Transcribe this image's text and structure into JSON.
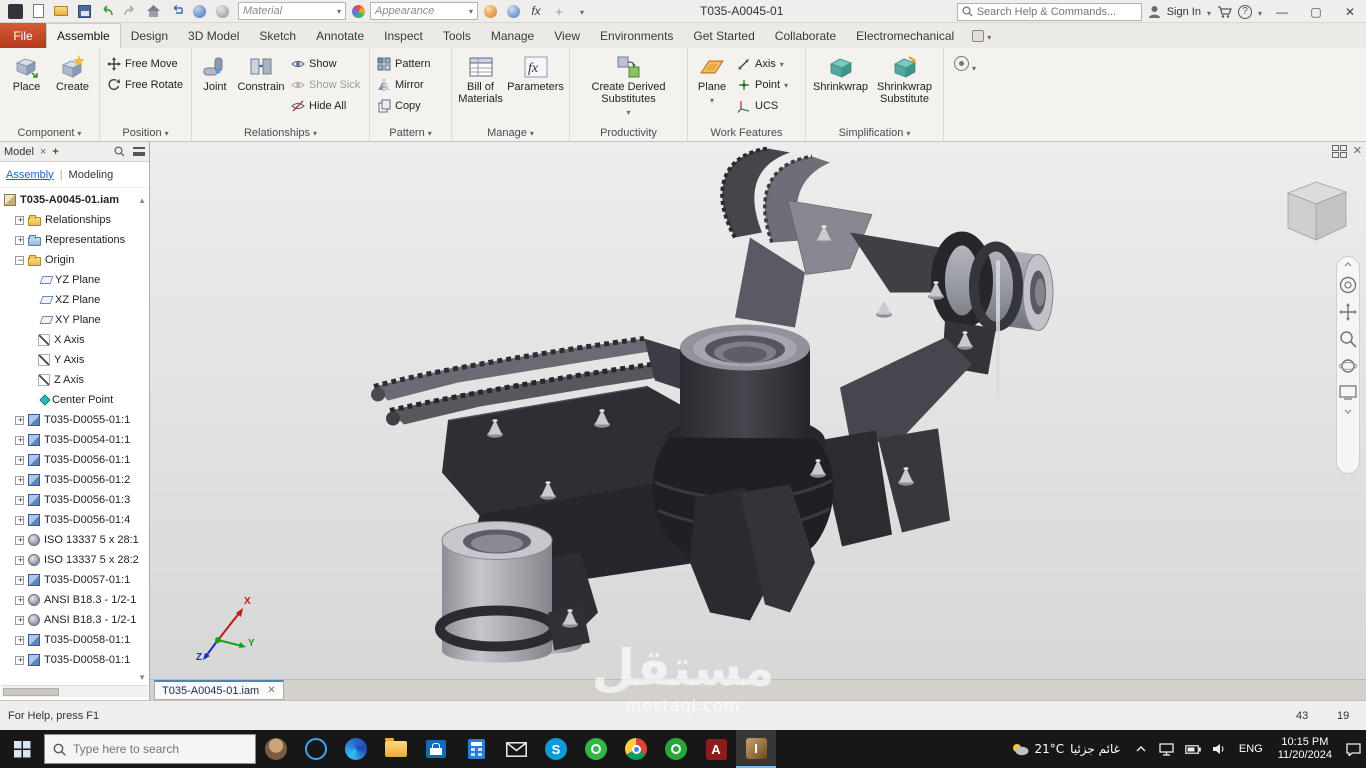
{
  "titlebar": {
    "title": "T035-A0045-01",
    "material_value": "Material",
    "appearance_value": "Appearance",
    "search_placeholder": "Search Help & Commands...",
    "sign_in_label": "Sign In",
    "fx_label": "fx"
  },
  "tabs": {
    "file": "File",
    "items": [
      "Assemble",
      "Design",
      "3D Model",
      "Sketch",
      "Annotate",
      "Inspect",
      "Tools",
      "Manage",
      "View",
      "Environments",
      "Get Started",
      "Collaborate",
      "Electromechanical"
    ]
  },
  "ribbon": {
    "component": {
      "label": "Component",
      "place": "Place",
      "create": "Create"
    },
    "position": {
      "label": "Position",
      "free_move": "Free Move",
      "free_rotate": "Free Rotate"
    },
    "relationships": {
      "label": "Relationships",
      "joint": "Joint",
      "constrain": "Constrain",
      "show": "Show",
      "show_sick": "Show Sick",
      "hide_all": "Hide All"
    },
    "pattern": {
      "label": "Pattern",
      "pattern": "Pattern",
      "mirror": "Mirror",
      "copy": "Copy"
    },
    "manage": {
      "label": "Manage",
      "bom": "Bill of Materials",
      "parameters": "Parameters"
    },
    "productivity": {
      "label": "Productivity",
      "create_derived": "Create Derived Substitutes"
    },
    "work_features": {
      "label": "Work Features",
      "plane": "Plane",
      "axis": "Axis",
      "point": "Point",
      "ucs": "UCS"
    },
    "simplification": {
      "label": "Simplification",
      "shrinkwrap": "Shrinkwrap",
      "shrinkwrap_sub": "Shrinkwrap Substitute"
    }
  },
  "browser": {
    "panel_title": "Model",
    "tab_assembly": "Assembly",
    "tab_modeling": "Modeling",
    "tree": [
      {
        "label": "T035-A0045-01.iam"
      },
      {
        "label": "Relationships"
      },
      {
        "label": "Representations"
      },
      {
        "label": "Origin"
      },
      {
        "label": "YZ Plane"
      },
      {
        "label": "XZ Plane"
      },
      {
        "label": "XY Plane"
      },
      {
        "label": "X Axis"
      },
      {
        "label": "Y Axis"
      },
      {
        "label": "Z Axis"
      },
      {
        "label": "Center Point"
      },
      {
        "label": "T035-D0055-01:1"
      },
      {
        "label": "T035-D0054-01:1"
      },
      {
        "label": "T035-D0056-01:1"
      },
      {
        "label": "T035-D0056-01:2"
      },
      {
        "label": "T035-D0056-01:3"
      },
      {
        "label": "T035-D0056-01:4"
      },
      {
        "label": "ISO 13337 5 x 28:1"
      },
      {
        "label": "ISO 13337 5 x 28:2"
      },
      {
        "label": "T035-D0057-01:1"
      },
      {
        "label": "ANSI B18.3 - 1/2-1"
      },
      {
        "label": "ANSI B18.3 - 1/2-1"
      },
      {
        "label": "T035-D0058-01:1"
      },
      {
        "label": "T035-D0058-01:1"
      }
    ]
  },
  "viewport": {
    "doc_tab": "T035-A0045-01.iam",
    "axis_x": "X",
    "axis_y": "Y",
    "axis_z": "Z"
  },
  "watermark": {
    "arabic": "مستقل",
    "domain": "mostaql.com"
  },
  "statusbar": {
    "help": "For Help, press F1",
    "count1": "43",
    "count2": "19"
  },
  "taskbar": {
    "search_placeholder": "Type here to search",
    "weather_temp": "21°C",
    "weather_desc": "غائم جزئيا",
    "lang": "ENG",
    "time": "10:15 PM",
    "date": "11/20/2024"
  }
}
